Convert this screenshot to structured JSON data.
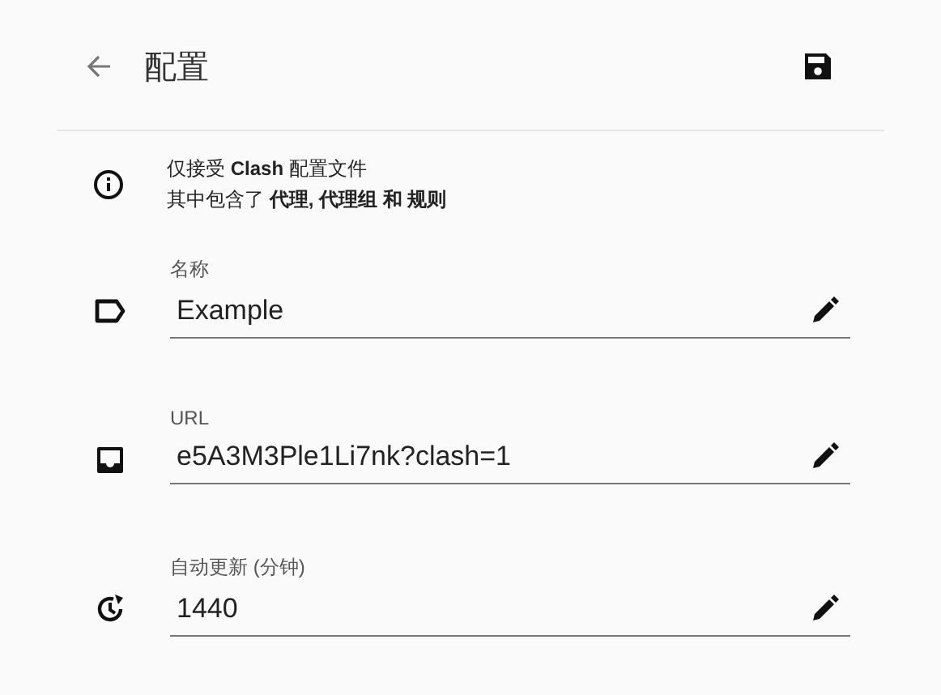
{
  "header": {
    "title": "配置"
  },
  "notice": [
    "仅接受 **Clash** 配置文件",
    "其中包含了 **代理, 代理组 和 规则**"
  ],
  "fields": [
    {
      "label": "名称",
      "value": "Example"
    },
    {
      "label": "URL",
      "value": "e5A3M3Ple1Li7nk?clash=1"
    },
    {
      "label": "自动更新 (分钟)",
      "value": "1440"
    }
  ]
}
